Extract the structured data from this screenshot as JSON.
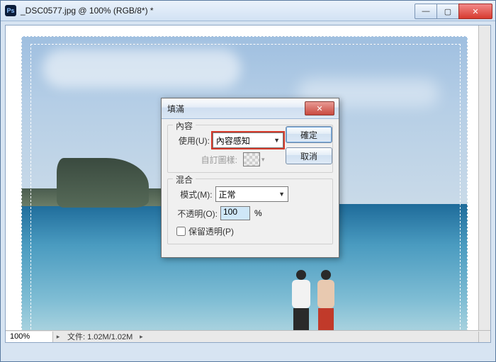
{
  "window": {
    "title": "_DSC0577.jpg @ 100% (RGB/8*) *",
    "zoom": "100%",
    "status_label": "文件:",
    "status_value": "1.02M/1.02M"
  },
  "dialog": {
    "title": "填滿",
    "ok": "確定",
    "cancel": "取消",
    "content": {
      "legend": "內容",
      "use_label": "使用(U):",
      "use_value": "內容感知",
      "pattern_label": "自訂圖樣:"
    },
    "blend": {
      "legend": "混合",
      "mode_label": "模式(M):",
      "mode_value": "正常",
      "opacity_label": "不透明(O):",
      "opacity_value": "100",
      "opacity_unit": "%",
      "preserve_label": "保留透明(P)"
    }
  }
}
